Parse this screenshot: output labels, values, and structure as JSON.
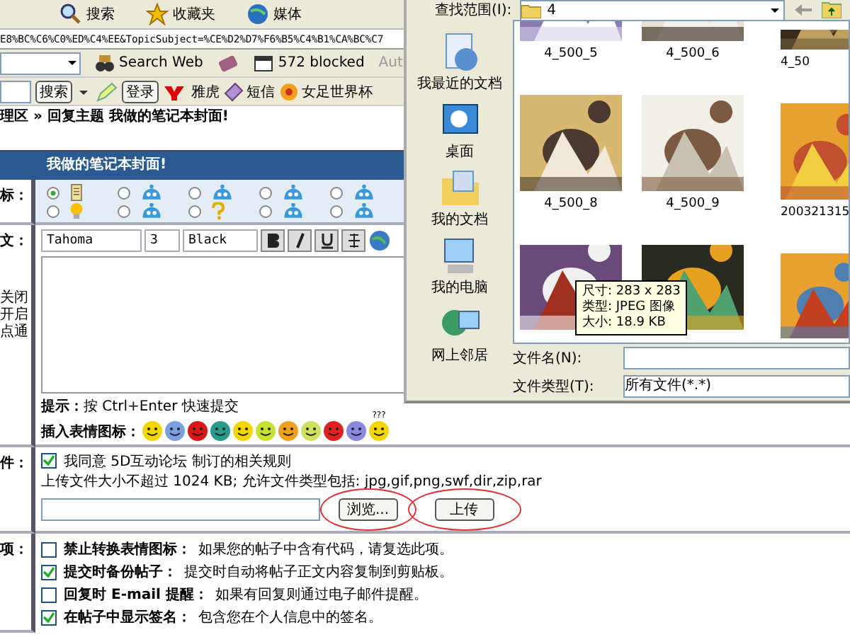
{
  "toolbar": {
    "buttons": [
      {
        "kind": "search",
        "label": "搜索"
      },
      {
        "kind": "favorites",
        "label": "收藏夹"
      },
      {
        "kind": "media",
        "label": "媒体"
      }
    ]
  },
  "address": "E8%BC%C6%C0%ED%C4%EE&TopicSubject=%CE%D2%D7%F6%B5%C4%B1%CA%BC%C7",
  "search_toolbar": {
    "search_web": "Search Web",
    "blocked": "572 blocked",
    "auto": "Aut"
  },
  "cn_toolbar": {
    "search_button": "搜索",
    "login_button": "登录",
    "links": [
      {
        "kind": "yahoo",
        "label": "雅虎"
      },
      {
        "kind": "sms",
        "label": "短信"
      },
      {
        "kind": "ball",
        "label": "女足世界杯"
      }
    ]
  },
  "breadcrumb": "理区 » 回复主题 我做的笔记本封面!",
  "form": {
    "header": "我做的笔记本封面!",
    "icon_label": "标：",
    "icons": [
      {
        "kind": "note",
        "selected": true
      },
      {
        "kind": "blob",
        "selected": false
      },
      {
        "kind": "blob",
        "selected": false
      },
      {
        "kind": "blob",
        "selected": false
      },
      {
        "kind": "blob",
        "selected": false
      },
      {
        "kind": "bulb",
        "selected": false
      },
      {
        "kind": "blob",
        "selected": false
      },
      {
        "kind": "question",
        "selected": false
      },
      {
        "kind": "blob",
        "selected": false
      },
      {
        "kind": "blob",
        "selected": false
      }
    ],
    "body_label": "文：",
    "body_notes": [
      "关闭",
      "开启",
      "点通"
    ],
    "editor": {
      "font": "Tahoma",
      "size": "3",
      "forecolor_name": "Black"
    },
    "hint": "**提示：**按 Ctrl+Enter 快速提交",
    "emoticon_label": "插入表情图标：",
    "emoticons": [
      {
        "color": "#f2d600"
      },
      {
        "color": "#7aa0e0"
      },
      {
        "color": "#d81818"
      },
      {
        "color": "#2a9a8a"
      },
      {
        "color": "#f2d600"
      },
      {
        "color": "#c8e030"
      },
      {
        "color": "#f0a020"
      },
      {
        "color": "#d0e060"
      },
      {
        "color": "#e02020"
      },
      {
        "color": "#8888e0"
      },
      {
        "color": "#f2d600",
        "caption": "???"
      }
    ],
    "file_label": "件：",
    "agree": {
      "checked": true,
      "text": "我同意 5D互动论坛 制订的相关规则"
    },
    "upload_note": "上传文件大小不超过 1024 KB; 允许文件类型包括: jpg,gif,png,swf,dir,zip,rar",
    "browse_button": "浏览...",
    "upload_button": "上传",
    "options_label": "项：",
    "options": [
      {
        "checked": false,
        "title": "禁止转换表情图标：",
        "text": "如果您的帖子中含有代码，请复选此项。"
      },
      {
        "checked": true,
        "title": "提交时备份帖子：",
        "text": "提交时自动将帖子正文内容复制到剪贴板。"
      },
      {
        "checked": false,
        "title": "回复时 E-mail 提醒：",
        "text": "如果有回复则通过电子邮件提醒。"
      },
      {
        "checked": true,
        "title": "在帖子中显示签名：",
        "text": "包含您在个人信息中的签名。"
      }
    ]
  },
  "dialog": {
    "look_in_label": "查找范围(I):",
    "look_in": "4",
    "places": [
      {
        "kind": "recent",
        "label": "我最近的文档"
      },
      {
        "kind": "desktop",
        "label": "桌面"
      },
      {
        "kind": "documents",
        "label": "我的文档"
      },
      {
        "kind": "computer",
        "label": "我的电脑"
      },
      {
        "kind": "network",
        "label": "网上邻居"
      }
    ],
    "files": [
      {
        "kind": "picture",
        "name": "4_500_5"
      },
      {
        "kind": "picture",
        "name": "4_500_6"
      },
      {
        "kind": "picture",
        "name": "4_50"
      },
      {
        "kind": "picture",
        "name": "4_500_8"
      },
      {
        "kind": "picture",
        "name": "4_500_9"
      },
      {
        "kind": "picture",
        "name": "200321315"
      },
      {
        "kind": "picture"
      },
      {
        "kind": "picture"
      },
      {
        "kind": "picture"
      }
    ],
    "tooltip": [
      "尺寸: 283 x 283",
      "类型: JPEG 图像",
      "大小: 18.9 KB"
    ],
    "file_name_label": "文件名(N):",
    "file_type_label": "文件类型(T):",
    "file_type": "所有文件(*.*)"
  }
}
